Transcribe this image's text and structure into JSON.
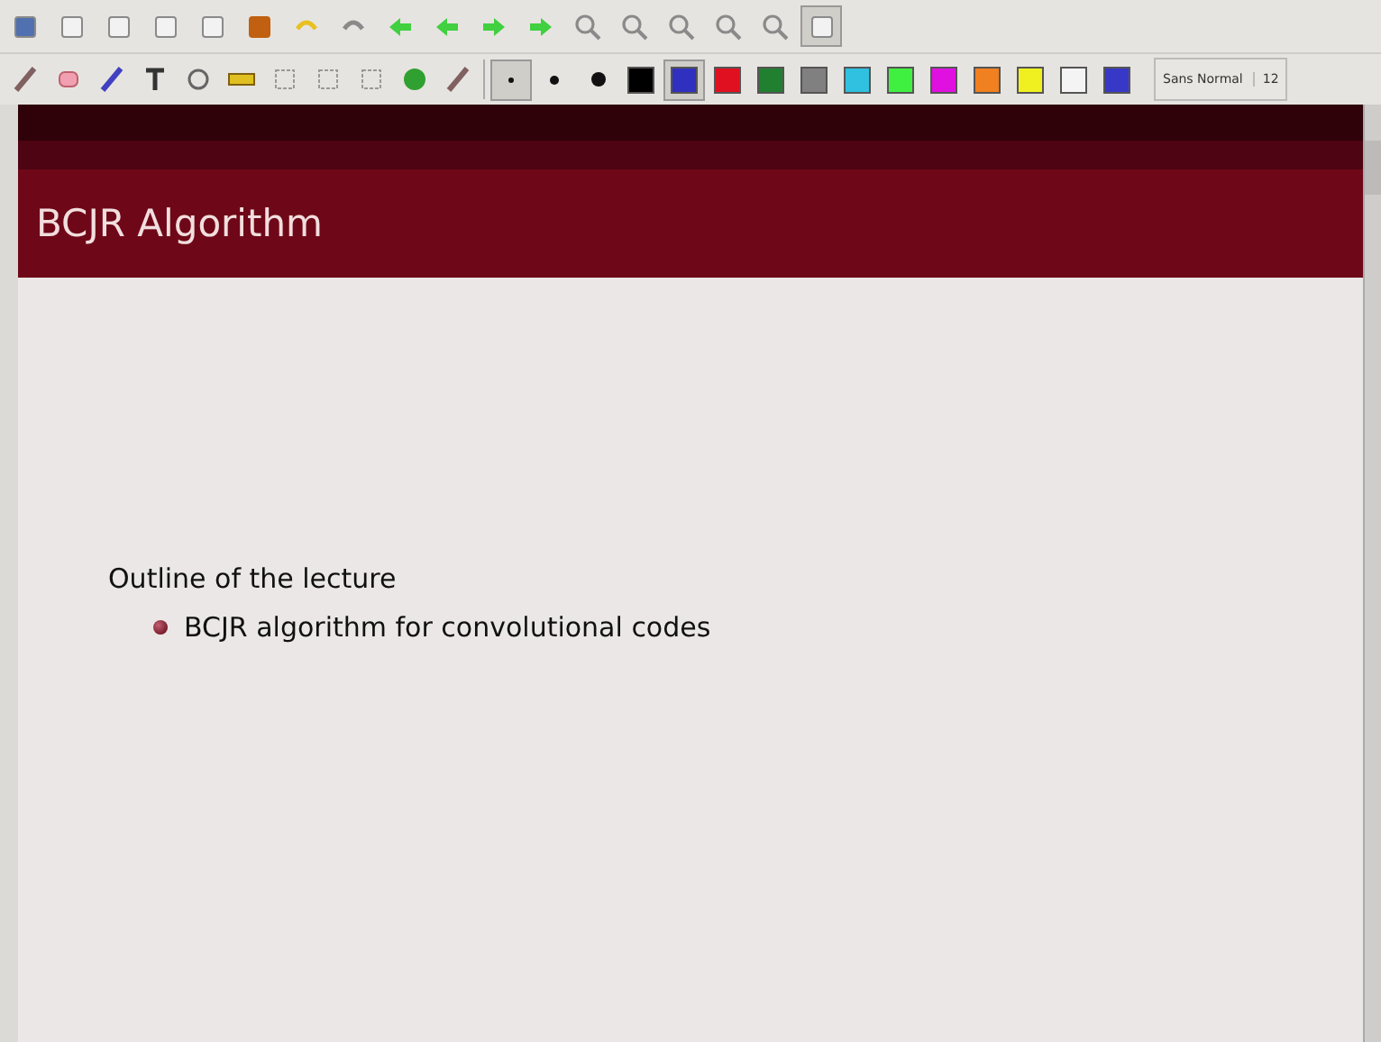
{
  "pen_sizes": [
    {
      "selected": true
    },
    {
      "selected": false
    },
    {
      "selected": false
    }
  ],
  "colors": [
    {
      "color": "#000000",
      "selected": false
    },
    {
      "color": "#3030c0",
      "selected": true
    },
    {
      "color": "#e01020",
      "selected": false
    },
    {
      "color": "#208030",
      "selected": false
    },
    {
      "color": "#808080",
      "selected": false
    },
    {
      "color": "#30c0e0",
      "selected": false
    },
    {
      "color": "#40f040",
      "selected": false
    },
    {
      "color": "#e010e0",
      "selected": false
    },
    {
      "color": "#f08020",
      "selected": false
    },
    {
      "color": "#f0f020",
      "selected": false
    },
    {
      "color": "#f4f4f4",
      "selected": false
    },
    {
      "color": "#3838c8",
      "selected": false
    }
  ],
  "font_button": {
    "family": "Sans Normal",
    "size": "12"
  },
  "slide": {
    "title": "BCJR Algorithm",
    "heading": "Outline of the lecture",
    "bullets": [
      "BCJR algorithm for convolutional codes"
    ]
  }
}
